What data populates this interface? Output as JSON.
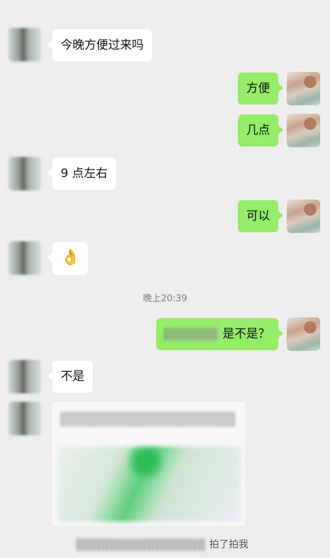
{
  "messages": [
    {
      "side": "left",
      "text": "今晚方便过来吗"
    },
    {
      "side": "right",
      "text": "方便"
    },
    {
      "side": "right",
      "text": "几点"
    },
    {
      "side": "left",
      "text": "9 点左右"
    },
    {
      "side": "right",
      "text": "可以"
    },
    {
      "side": "left",
      "emoji": "👌"
    },
    {
      "side": "right",
      "text": "是不是？"
    },
    {
      "side": "left",
      "text": "不是"
    }
  ],
  "timestamp": "晚上20:39",
  "system": {
    "pat_text": "拍了拍我"
  },
  "colors": {
    "background": "#ededed",
    "sent_bubble": "#95ec69",
    "received_bubble": "#ffffff"
  }
}
